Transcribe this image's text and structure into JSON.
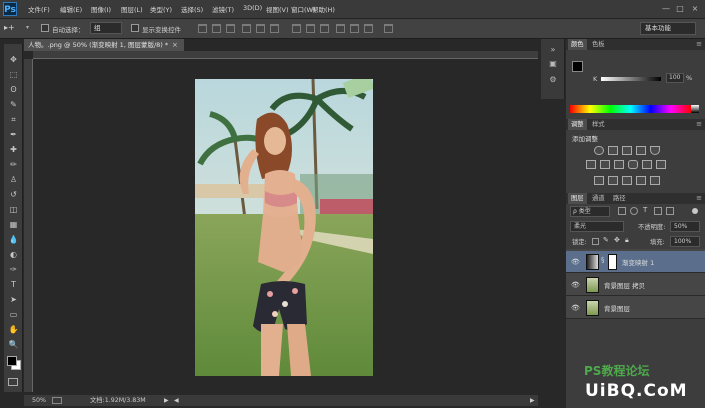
{
  "app": {
    "logo": "Ps"
  },
  "menu": [
    "文件(F)",
    "编辑(E)",
    "图像(I)",
    "图层(L)",
    "类型(Y)",
    "选择(S)",
    "滤镜(T)",
    "3D(D)",
    "视图(V)",
    "窗口(W)",
    "帮助(H)"
  ],
  "window_controls": [
    "—",
    "□",
    "×"
  ],
  "options": {
    "tool_glyph": "▸+",
    "auto_select_label": "自动选择：",
    "auto_select_value": "组",
    "show_transform_label": "显示变换控件",
    "workspace": "基本功能"
  },
  "document": {
    "tab_title": "人物。.png @ 50% (渐变映射 1, 图层蒙版/8) *",
    "tab_close": "×",
    "zoom": "50%",
    "doc_size": "文档:1.92M/3.83M"
  },
  "tools": [
    "move-icon",
    "marquee-icon",
    "lasso-icon",
    "quick-select-icon",
    "crop-icon",
    "eyedropper-icon",
    "healing-icon",
    "brush-icon",
    "stamp-icon",
    "history-brush-icon",
    "eraser-icon",
    "gradient-icon",
    "blur-icon",
    "dodge-icon",
    "pen-icon",
    "type-icon",
    "path-select-icon",
    "shape-icon",
    "hand-icon",
    "zoom-icon"
  ],
  "tool_glyphs": [
    "✥",
    "⬚",
    "ʘ",
    "✎",
    "⌗",
    "✒",
    "✚",
    "✏",
    "♙",
    "↺",
    "◫",
    "▦",
    "💧",
    "◐",
    "✑",
    "T",
    "➤",
    "▭",
    "✋",
    "🔍"
  ],
  "color_panel": {
    "tabs": [
      "颜色",
      "色板"
    ],
    "k_label": "K",
    "k_value": "100",
    "pct": "%"
  },
  "adjustments_panel": {
    "tabs": [
      "调整",
      "样式"
    ],
    "title": "添加调整"
  },
  "layers_panel": {
    "tabs": [
      "图层",
      "通道",
      "路径"
    ],
    "kind": "ρ 类型",
    "blend_mode": "柔光",
    "opacity_label": "不透明度:",
    "opacity_value": "50%",
    "lock_label": "锁定:",
    "fill_label": "填充:",
    "fill_value": "100%",
    "layers": [
      {
        "name": "渐变映射 1",
        "selected": true
      },
      {
        "name": "背景图层 拷贝",
        "selected": false
      },
      {
        "name": "背景图层",
        "selected": false
      }
    ]
  },
  "watermark": {
    "line1": "PS教程论坛",
    "line2": "UiBQ.CoM"
  },
  "colors": {
    "accent": "#1473e6",
    "selected_layer": "#5b6f8c",
    "ps_blue": "#31a8ff"
  }
}
